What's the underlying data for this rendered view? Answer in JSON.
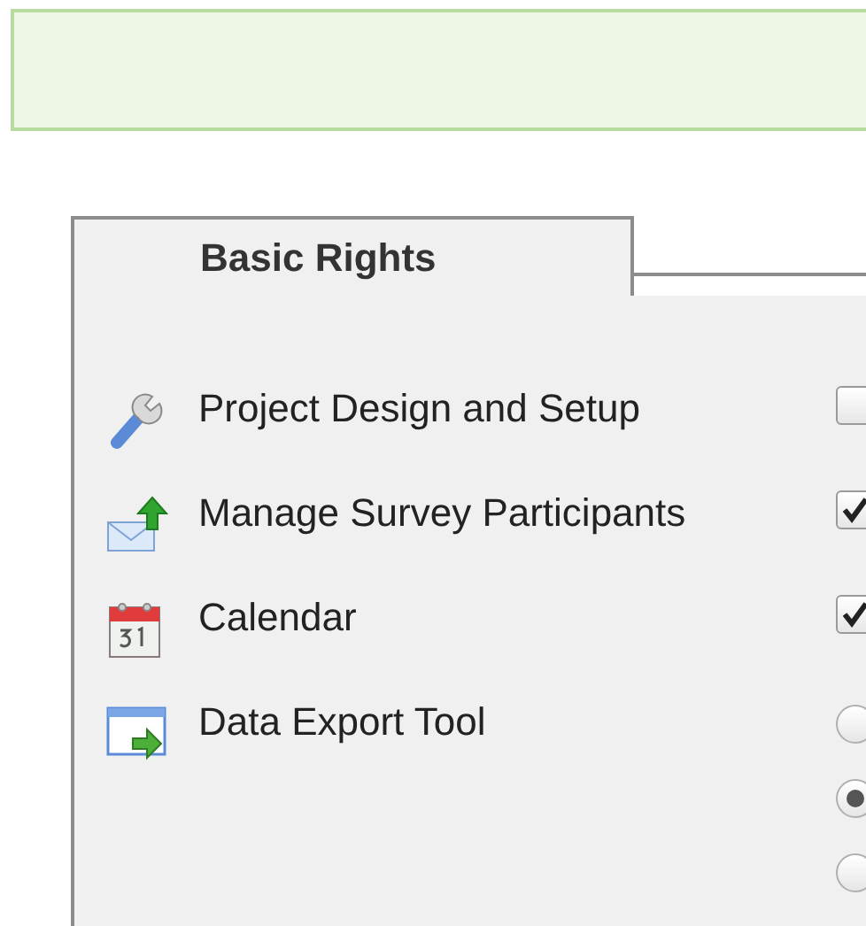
{
  "tab": {
    "label": "Basic Rights",
    "selected": true
  },
  "rights": [
    {
      "label": "Project Design and Setup",
      "kind": "checkbox",
      "checked": false
    },
    {
      "label": "Manage Survey Participants",
      "kind": "checkbox",
      "checked": true
    },
    {
      "label": "Calendar",
      "kind": "checkbox",
      "checked": true
    },
    {
      "label": "Data Export Tool",
      "kind": "radio",
      "options": [
        {
          "selected": false
        },
        {
          "selected": true
        },
        {
          "selected": false
        }
      ]
    }
  ]
}
